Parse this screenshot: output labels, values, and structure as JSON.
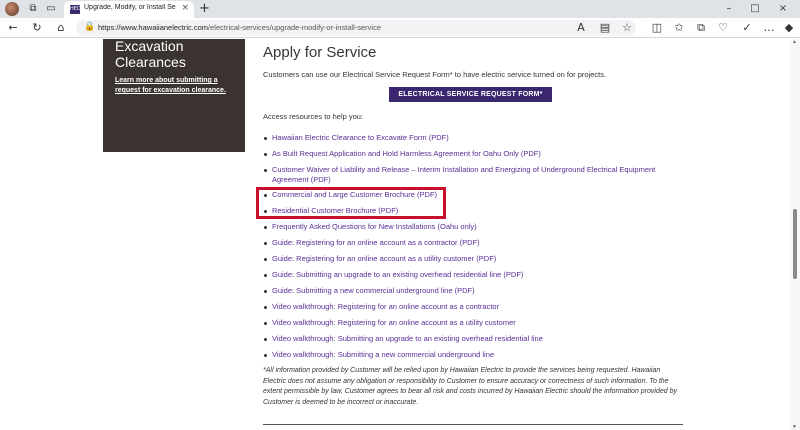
{
  "browser": {
    "tab_title": "Upgrade, Modify, or Install Servic",
    "tab_favicon": "HEO",
    "url_host": "https://www.hawaiianelectric.com",
    "url_path": "/electrical-services/upgrade-modify-or-install-service"
  },
  "sidebar_card": {
    "heading": "Excavation Clearances",
    "link": "Learn more about submitting a request for excavation clearance."
  },
  "main": {
    "title": "Apply for Service",
    "intro": "Customers can use our Electrical Service Request Form* to have electric service turned on for projects.",
    "cta_label": "ELECTRICAL SERVICE REQUEST FORM*",
    "access_label": "Access resources to help you:",
    "resources": [
      "Hawaiian Electric Clearance to Excavate Form (PDF)",
      "As Built Request Application and Hold Harmless Agreement for Oahu Only (PDF)",
      "Customer Waiver of Liability and Release – Interim Installation and Energizing of Underground Electrical Equipment Agreement (PDF)",
      "Commercial and Large Customer Brochure (PDF)",
      "Residential Customer Brochure (PDF)",
      "Frequently Asked Questions for New Installations (Oahu only)",
      "Guide: Registering for an online account as a contractor (PDF)",
      "Guide: Registering for an online account as a utility customer (PDF)",
      "Guide: Submitting an upgrade to an existing overhead residential line (PDF)",
      "Guide: Submitting a new commercial underground line (PDF)",
      "Video walkthrough: Registering for an online account as a contractor",
      "Video walkthrough: Registering for an online account as a utility customer",
      "Video walkthrough: Submitting an upgrade to an existing overhead residential line",
      "Video walkthrough: Submitting a new commercial underground line"
    ],
    "disclaimer": "*All information provided by Customer will be relied upon by Hawaiian Electric to provide the services being requested. Hawaiian Electric does not assume any obligation or responsibility to Customer to ensure accuracy or correctness of such information. To the extent permissible by law, Customer agrees to bear all risk and costs incurred by Hawaiian Electric should the information provided by Customer is deemed to be incorrect or inaccurate."
  },
  "colors": {
    "cta_bg": "#3b2670",
    "link": "#5a2d96",
    "card_bg": "#3b3331",
    "highlight": "#c8102e"
  }
}
